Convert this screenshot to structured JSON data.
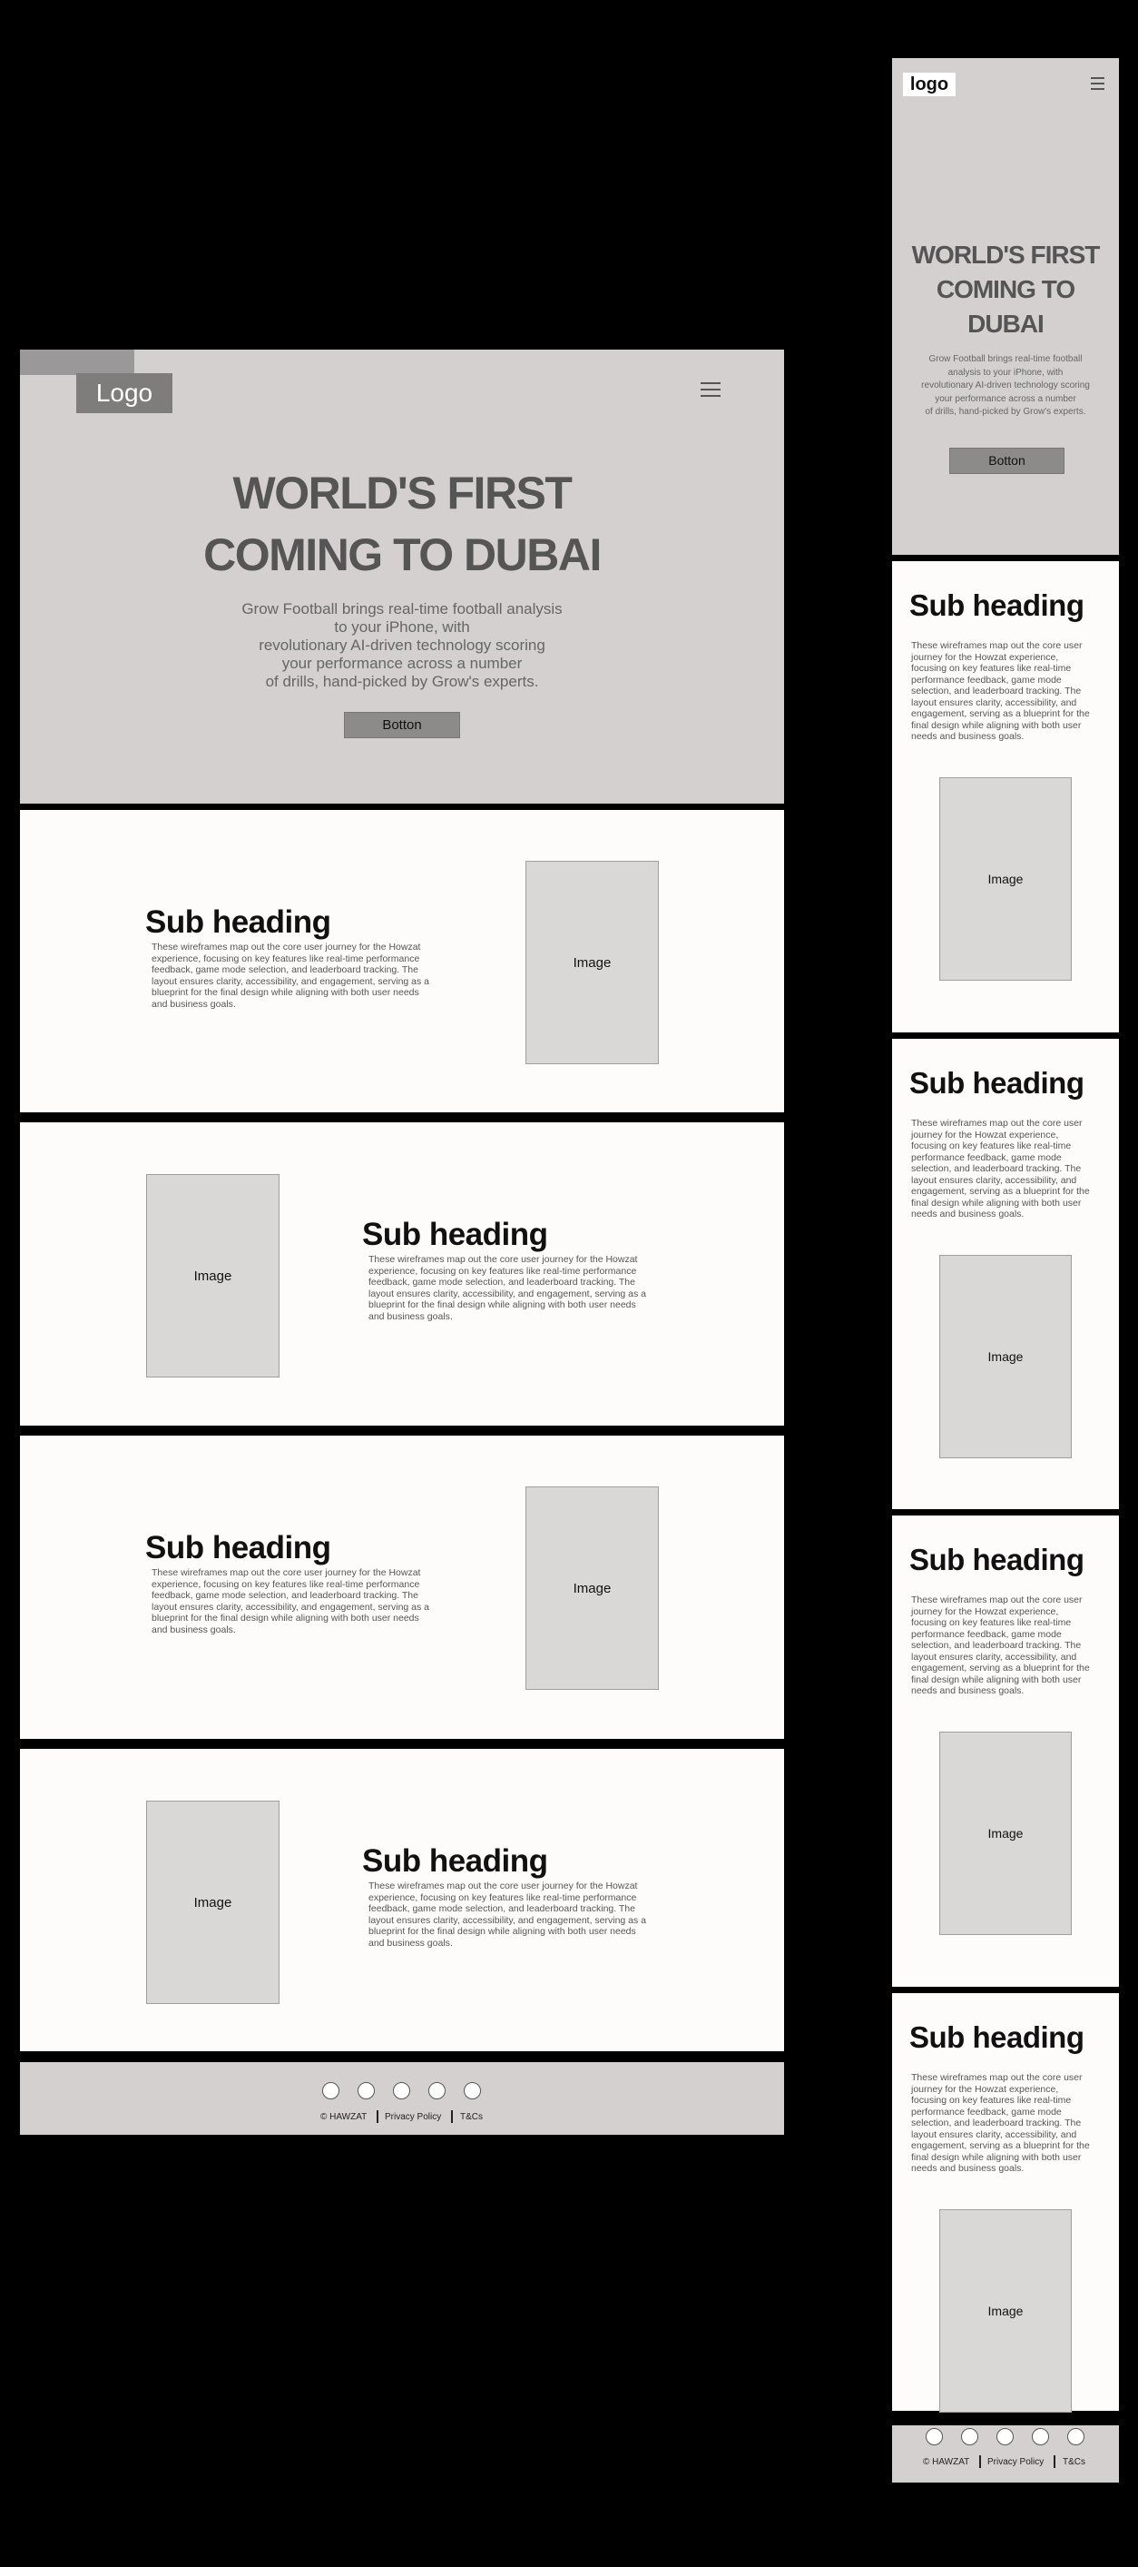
{
  "desktop": {
    "logo": "Logo",
    "hero": {
      "title_line1": "WORLD'S FIRST",
      "title_line2": "COMING TO DUBAI",
      "desc_lines": [
        "Grow Football brings real-time football analysis",
        "to your iPhone, with",
        "revolutionary AI-driven technology scoring",
        "your performance across a number",
        "of drills, hand-picked by Grow's experts."
      ],
      "button": "Botton"
    },
    "sections": [
      {
        "heading": "Sub heading",
        "image": "Image",
        "lines": [
          "These wireframes map out the core user journey for the Howzat",
          "experience, focusing on key features like real-time performance",
          "feedback, game mode selection, and leaderboard tracking. The",
          "layout ensures clarity, accessibility, and engagement, serving as a",
          "blueprint for the final design while aligning with both user needs",
          "and business goals."
        ]
      },
      {
        "heading": "Sub heading",
        "image": "Image",
        "lines": [
          "These wireframes map out the core user journey for the Howzat",
          "experience, focusing on key features like real-time performance",
          "feedback, game mode selection, and leaderboard tracking. The",
          "layout ensures clarity, accessibility, and engagement, serving as a",
          "blueprint for the final design while aligning with both user needs",
          "and business goals."
        ]
      },
      {
        "heading": "Sub heading",
        "image": "Image",
        "lines": [
          "These wireframes map out the core user journey for the Howzat",
          "experience, focusing on key features like real-time performance",
          "feedback, game mode selection, and leaderboard tracking. The",
          "layout ensures clarity, accessibility, and engagement, serving as a",
          "blueprint for the final design while aligning with both user needs",
          "and business goals."
        ]
      },
      {
        "heading": "Sub heading",
        "image": "Image",
        "lines": [
          "These wireframes map out the core user journey for the Howzat",
          "experience, focusing on key features like real-time performance",
          "feedback, game mode selection, and leaderboard tracking. The",
          "layout ensures clarity, accessibility, and engagement, serving as a",
          "blueprint for the final design while aligning with both user needs",
          "and business goals."
        ]
      }
    ],
    "footer": {
      "copyright": "© HAWZAT",
      "privacy": "Privacy Policy",
      "terms": "T&Cs"
    }
  },
  "mobile": {
    "logo": "logo",
    "hero": {
      "title_lines": [
        "WORLD'S FIRST",
        "COMING TO",
        "DUBAI"
      ],
      "desc_lines": [
        "Grow Football brings real-time football",
        "analysis to your iPhone, with",
        "revolutionary AI-driven technology scoring",
        "your performance across a number",
        "of drills, hand-picked by Grow's experts."
      ],
      "button": "Botton"
    },
    "sections": [
      {
        "heading": "Sub heading",
        "image": "Image",
        "lines": [
          "These wireframes map out the core user",
          "journey for the Howzat experience,",
          "focusing on key features like real-time",
          "performance feedback, game mode",
          "selection, and leaderboard tracking. The",
          "layout ensures clarity, accessibility, and",
          "engagement, serving as a blueprint for the",
          "final design while aligning with both user",
          "needs and business goals."
        ]
      },
      {
        "heading": "Sub heading",
        "image": "Image",
        "lines": [
          "These wireframes map out the core user",
          "journey for the Howzat experience,",
          "focusing on key features like real-time",
          "performance feedback, game mode",
          "selection, and leaderboard tracking. The",
          "layout ensures clarity, accessibility, and",
          "engagement, serving as a blueprint for the",
          "final design while aligning with both user",
          "needs and business goals."
        ]
      },
      {
        "heading": "Sub heading",
        "image": "Image",
        "lines": [
          "These wireframes map out the core user",
          "journey for the Howzat experience,",
          "focusing on key features like real-time",
          "performance feedback, game mode",
          "selection, and leaderboard tracking. The",
          "layout ensures clarity, accessibility, and",
          "engagement, serving as a blueprint for the",
          "final design while aligning with both user",
          "needs and business goals."
        ]
      },
      {
        "heading": "Sub heading",
        "image": "Image",
        "lines": [
          "These wireframes map out the core user",
          "journey for the Howzat experience,",
          "focusing on key features like real-time",
          "performance feedback, game mode",
          "selection, and leaderboard tracking. The",
          "layout ensures clarity, accessibility, and",
          "engagement, serving as a blueprint for the",
          "final design while aligning with both user",
          "needs and business goals."
        ]
      }
    ],
    "footer": {
      "copyright": "© HAWZAT",
      "privacy": "Privacy Policy",
      "terms": "T&Cs"
    }
  },
  "icons": {
    "menu": "hamburger-menu-icon",
    "social": "social-circle-icon"
  },
  "colors": {
    "background": "#000000",
    "hero_bg": "#d3d0cf",
    "card_bg": "#fefcfb",
    "button_bg": "#8d8b8a",
    "image_bg": "#d9d8d7"
  }
}
